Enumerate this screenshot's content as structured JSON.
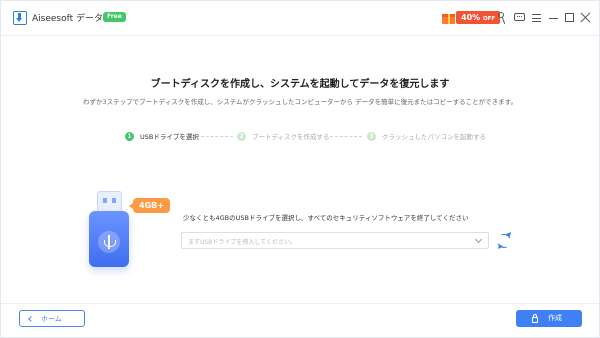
{
  "app": {
    "title": "Aiseesoft データ復元",
    "badge": "Free"
  },
  "promo": {
    "discount": "40%",
    "off_label": "OFF"
  },
  "header": {
    "title": "ブートディスクを作成し、システムを起動してデータを復元します",
    "description": "わずか3ステップでブートディスクを作成し、システムがクラッシュしたコンピューターから データを簡単に復元またはコピーすることができます。"
  },
  "steps": [
    {
      "number": "1",
      "label": "USBドライブを選択",
      "state": "active"
    },
    {
      "number": "2",
      "label": "ブートディスクを作成する",
      "state": "inactive"
    },
    {
      "number": "3",
      "label": "クラッシュしたパソコンを起動する",
      "state": "inactive"
    }
  ],
  "usb": {
    "size_label": "4GB+"
  },
  "selection": {
    "instruction": "少なくとも4GBのUSBドライブを選択し、すべてのセキュリティソフトウェアを終了してください",
    "placeholder": "まずUSBドライブを挿入してください。"
  },
  "footer": {
    "home_label": "ホーム",
    "create_label": "作成"
  },
  "icons": {
    "titlebar": [
      "gift-icon",
      "key-icon",
      "chat-icon",
      "menu-icon",
      "minimize-icon",
      "maximize-icon",
      "close-icon"
    ],
    "other": [
      "usb-drive-icon",
      "refresh-icon",
      "chevron-down-icon",
      "chevron-left-icon",
      "lock-icon"
    ]
  },
  "colors": {
    "accent": "#3f80f5",
    "step_active": "#40c766",
    "promo": "#f25533",
    "usb_badge": "#ff9a44"
  }
}
